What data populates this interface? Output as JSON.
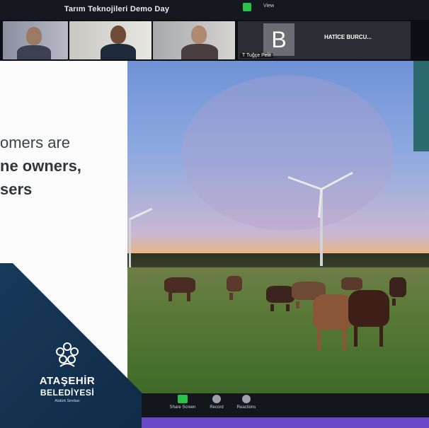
{
  "meeting": {
    "title": "Tarım Teknojileri Demo Day",
    "view_label": "View"
  },
  "participants": [
    {
      "name": "",
      "icon": "participant-video"
    },
    {
      "name": "",
      "icon": "participant-video"
    },
    {
      "name": "",
      "icon": "participant-video"
    },
    {
      "initial": "B",
      "name": "HATİCE BURCU...",
      "caption": "T Tuğçe Pelit"
    }
  ],
  "slide": {
    "lines": [
      "omers are",
      "ne owners,",
      "sers"
    ],
    "fragment": "n"
  },
  "logo": {
    "line1": "ATAŞEHİR",
    "line2": "BELEDİYESİ",
    "tagline": "Atatürk Sevdası"
  },
  "toolbar": {
    "buttons": [
      {
        "label": "Share Screen",
        "icon": "share-screen-icon",
        "color": "#29c14a"
      },
      {
        "label": "Record",
        "icon": "record-icon",
        "color": "#9aa1aa"
      },
      {
        "label": "Reactions",
        "icon": "reactions-icon",
        "color": "#9aa1aa"
      }
    ]
  },
  "colors": {
    "accent": "#6a48c7",
    "brand_navy": "#18395a",
    "record_green": "#29c14a"
  }
}
